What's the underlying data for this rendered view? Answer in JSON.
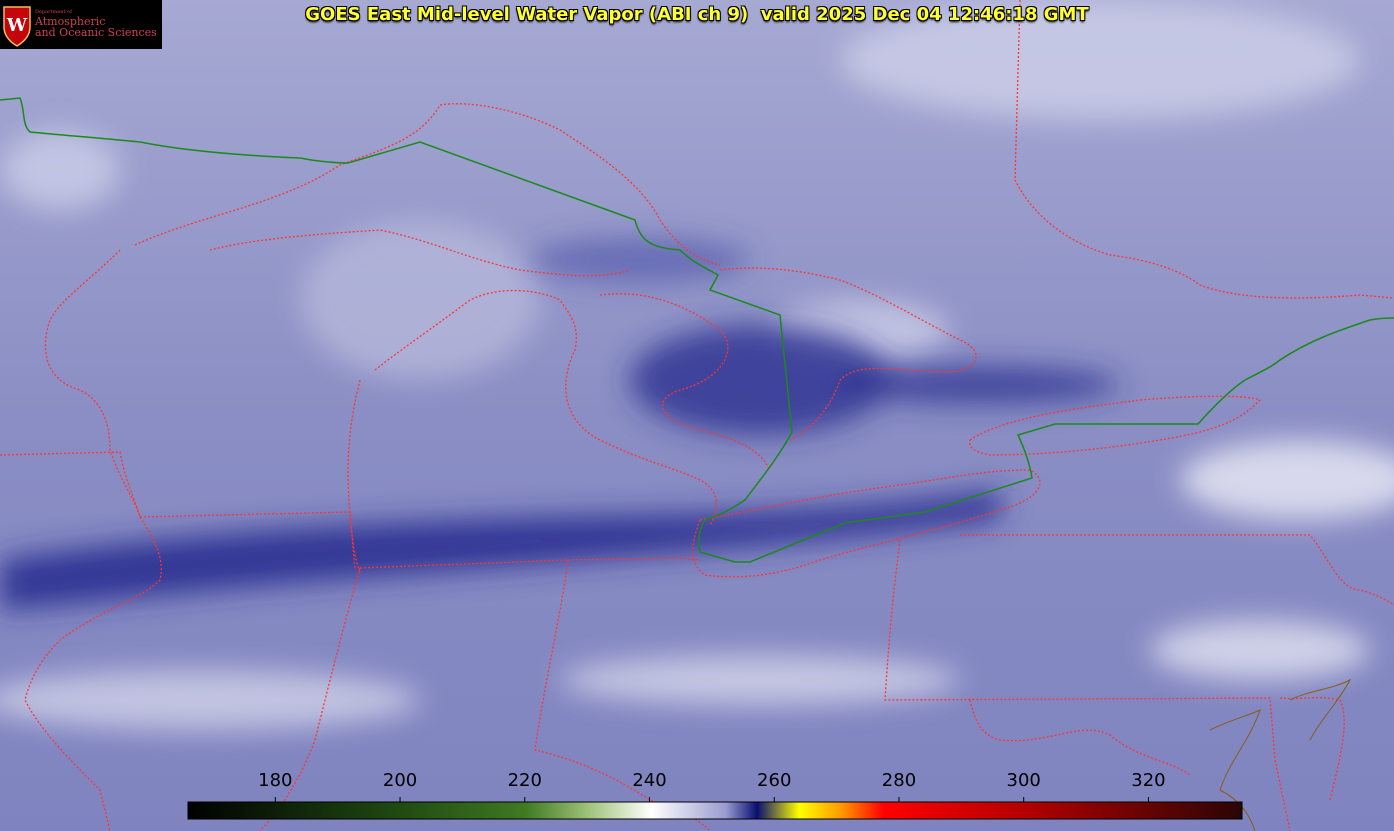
{
  "title": "GOES East Mid-level Water Vapor (ABI ch 9)  valid 2025 Dec 04 12:46:18 GMT",
  "logo": {
    "department": "Department of",
    "line1": "Atmospheric",
    "line2": "and Oceanic Sciences",
    "crest_letter": "W"
  },
  "colorbar": {
    "ticks": [
      {
        "value": 180,
        "label": "180"
      },
      {
        "value": 200,
        "label": "200"
      },
      {
        "value": 220,
        "label": "220"
      },
      {
        "value": 240,
        "label": "240"
      },
      {
        "value": 260,
        "label": "260"
      },
      {
        "value": 280,
        "label": "280"
      },
      {
        "value": 300,
        "label": "300"
      },
      {
        "value": 320,
        "label": "320"
      }
    ],
    "range": [
      166,
      335
    ],
    "colors": {
      "low": "#000000",
      "green": "#2f6a1a",
      "white": "#ffffff",
      "blue": "#1a1f8a",
      "yellow": "#ffff00",
      "red": "#ff0000",
      "dark_red": "#3a0a0a"
    }
  },
  "colors": {
    "state_borders": "#ff3333",
    "international_border": "#1a8a1a",
    "water_vapor_moist": "#2a2f90",
    "water_vapor_dry": "#e8e8f4"
  }
}
